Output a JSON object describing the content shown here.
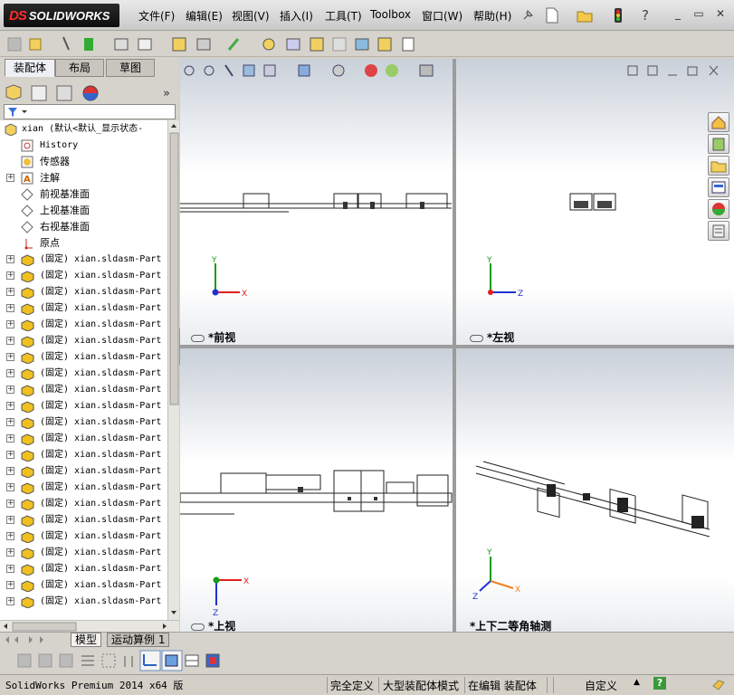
{
  "app": {
    "logo_ds": "DS",
    "logo_text": "SOLIDWORKS"
  },
  "menu": {
    "items": [
      "文件(F)",
      "编辑(E)",
      "视图(V)",
      "插入(I)",
      "工具(T)",
      "Toolbox",
      "窗口(W)",
      "帮助(H)"
    ]
  },
  "feature_manager": {
    "tabs": [
      "装配体",
      "布局",
      "草图"
    ],
    "root": "xian  (默认<默认_显示状态-",
    "nodes": [
      "History",
      "传感器",
      "注解",
      "前视基准面",
      "上视基准面",
      "右视基准面",
      "原点"
    ],
    "part_label": "(固定) xian.sldasm-Part"
  },
  "viewports": {
    "front_label": "*前视",
    "left_label": "*左视",
    "top_label": "*上视",
    "iso_label": "*上下二等角轴测",
    "axis_x": "X",
    "axis_y": "Y",
    "axis_z": "Z"
  },
  "model_tabs": [
    "模型",
    "运动算例 1"
  ],
  "status": {
    "version": "SolidWorks Premium 2014 x64 版",
    "defined": "完全定义",
    "mode": "大型装配体模式",
    "editing": "在编辑 装配体",
    "units": "自定义",
    "help": "?"
  },
  "colors": {
    "accent_red": "#e02020",
    "axis_green": "#1a9a1a",
    "axis_blue": "#2033d0",
    "part_yellow": "#f0c020"
  }
}
